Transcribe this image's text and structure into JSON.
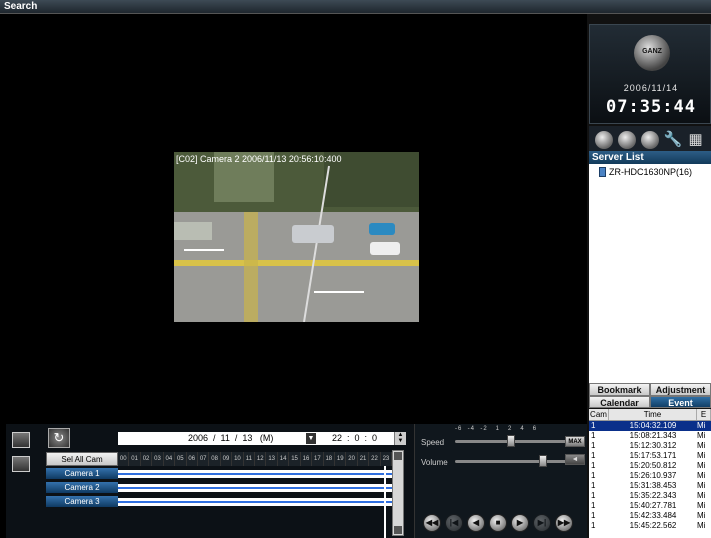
{
  "window": {
    "title": "Search"
  },
  "video": {
    "overlay_text": "[C02] Camera 2 2006/11/13 20:56:10:400"
  },
  "clock": {
    "logo_text": "GANZ",
    "date": "2006/11/14",
    "time": "07:35:44"
  },
  "toolbar": {
    "icons": [
      "camera-icon",
      "globe-icon",
      "storage-icon",
      "wrench-icon",
      "layout-icon"
    ]
  },
  "server_list": {
    "header": "Server List",
    "items": [
      "ZR-HDC1630NP(16)"
    ]
  },
  "tabs_row1": [
    "Bookmark",
    "Adjustment"
  ],
  "tabs_row2": [
    "Calendar",
    "Event"
  ],
  "event_table": {
    "headers": [
      "Cam",
      "Time",
      "E"
    ],
    "rows": [
      [
        "1",
        "15:04:32.109",
        "Mi"
      ],
      [
        "1",
        "15:08:21.343",
        "Mi"
      ],
      [
        "1",
        "15:12:30.312",
        "Mi"
      ],
      [
        "1",
        "15:17:53.171",
        "Mi"
      ],
      [
        "1",
        "15:20:50.812",
        "Mi"
      ],
      [
        "1",
        "15:26:10.937",
        "Mi"
      ],
      [
        "1",
        "15:31:38.453",
        "Mi"
      ],
      [
        "1",
        "15:35:22.343",
        "Mi"
      ],
      [
        "1",
        "15:40:27.781",
        "Mi"
      ],
      [
        "1",
        "15:42:33.484",
        "Mi"
      ],
      [
        "1",
        "15:45:22.562",
        "Mi"
      ]
    ]
  },
  "date_selector": {
    "date": "2006  /  11  /  13   (M)",
    "time": "22  :  0  :  0"
  },
  "timeline": {
    "select_all_label": "Sel All Cam",
    "hours": [
      "00",
      "01",
      "02",
      "03",
      "04",
      "05",
      "06",
      "07",
      "08",
      "09",
      "10",
      "11",
      "12",
      "13",
      "14",
      "15",
      "16",
      "17",
      "18",
      "19",
      "20",
      "21",
      "22",
      "23"
    ],
    "cameras": [
      "Camera 1",
      "Camera 2",
      "Camera 3"
    ]
  },
  "playback": {
    "speed_label": "Speed",
    "volume_label": "Volume",
    "speed_ticks": "-6  -4  -2   1   2   4   6",
    "max_label": "MAX",
    "buttons": [
      "◀◀",
      "|◀",
      "◀",
      "■",
      "▶",
      "▶|",
      "▶▶"
    ]
  }
}
